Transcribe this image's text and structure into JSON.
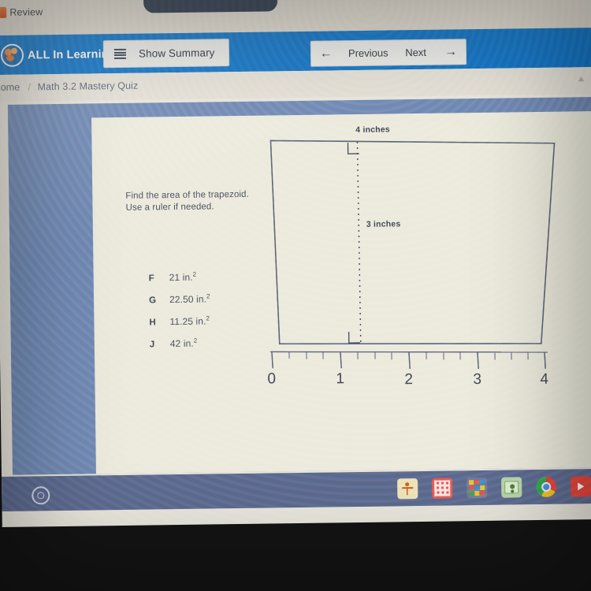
{
  "browser": {
    "tab_title": "Review",
    "tab_favicon_icon": "document-icon"
  },
  "appbar": {
    "brand_name": "ALL In Learning",
    "brand_logo_icon": "all-in-learning-logo-icon",
    "summary_button": {
      "label": "Show Summary",
      "icon": "list-icon"
    },
    "navigation": {
      "back_arrow_icon": "arrow-left-icon",
      "previous_label": "Previous",
      "next_label": "Next",
      "forward_arrow_icon": "arrow-right-icon"
    },
    "accent_color": "#1673c4"
  },
  "breadcrumb": {
    "home": "Home",
    "separator": "/",
    "current": "Math 3.2 Mastery Quiz",
    "scroll_top_icon": "chevron-up-icon"
  },
  "question": {
    "prompt_line1": "Find the area of the trapezoid.",
    "prompt_line2": "Use a ruler if needed.",
    "choices": [
      {
        "letter": "F",
        "value": "21 in.",
        "exponent": "2"
      },
      {
        "letter": "G",
        "value": "22.50 in.",
        "exponent": "2"
      },
      {
        "letter": "H",
        "value": "11.25 in.",
        "exponent": "2"
      },
      {
        "letter": "J",
        "value": "42 in.",
        "exponent": "2"
      }
    ]
  },
  "figure": {
    "top_label": "4 inches",
    "height_label": "3 inches",
    "shape": "trapezoid",
    "right_angle_markers": 2,
    "height_line_style": "dashed",
    "stroke_color": "#5b6378",
    "ruler": {
      "labels": [
        "0",
        "1",
        "2",
        "3",
        "4"
      ],
      "minor_ticks_per_unit": 4
    }
  },
  "taskbar": {
    "launcher_icon": "launcher-circle-icon",
    "apps": [
      {
        "icon": "classroom-app-icon"
      },
      {
        "icon": "grid-red-app-icon"
      },
      {
        "icon": "color-grid-app-icon"
      },
      {
        "icon": "whiteboard-app-icon"
      },
      {
        "icon": "chrome-icon"
      },
      {
        "icon": "youtube-icon"
      }
    ]
  }
}
